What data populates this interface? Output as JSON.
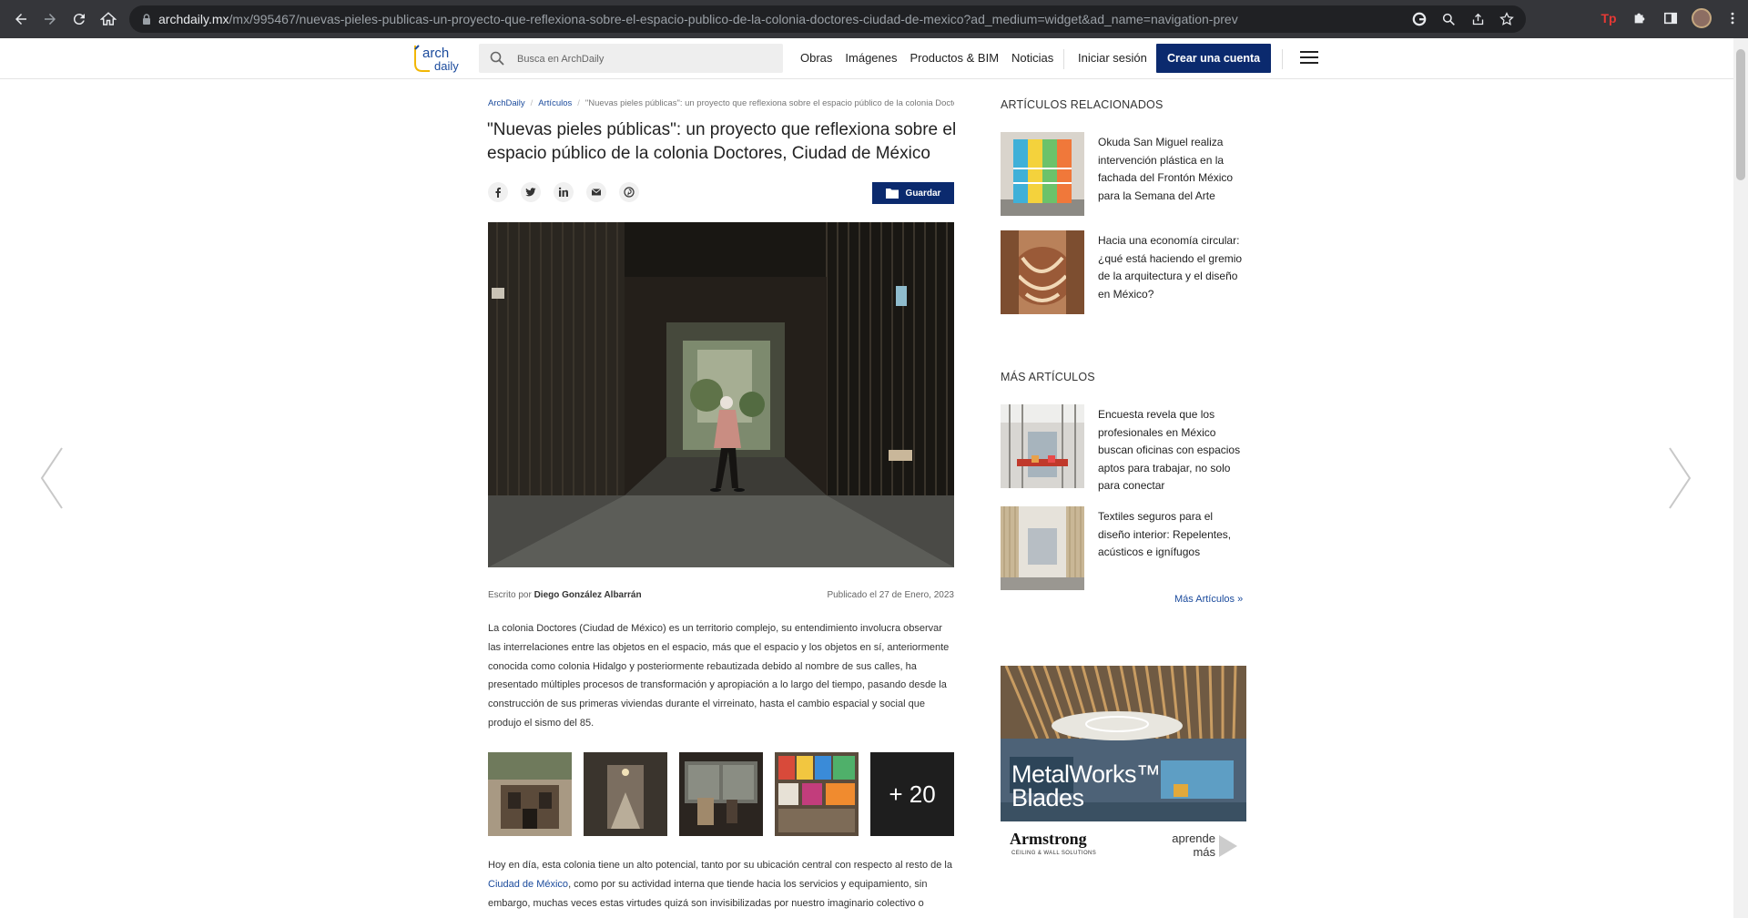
{
  "browser": {
    "url_host": "archdaily.mx",
    "url_path": "/mx/995467/nuevas-pieles-publicas-un-proyecto-que-reflexiona-sobre-el-espacio-publico-de-la-colonia-doctores-ciudad-de-mexico?ad_medium=widget&ad_name=navigation-prev",
    "extension_label": "Tp"
  },
  "header": {
    "logo_text_1": "arch",
    "logo_text_2": "daily",
    "search_placeholder": "Busca en ArchDaily",
    "nav": [
      "Obras",
      "Imágenes",
      "Productos & BIM",
      "Noticias"
    ],
    "login": "Iniciar sesión",
    "signup": "Crear una cuenta"
  },
  "article": {
    "breadcrumb": [
      "ArchDaily",
      "Artículos",
      "\"Nuevas pieles públicas\": un proyecto que reflexiona sobre el espacio público de la colonia Doctores, Ciudad de México"
    ],
    "title": "\"Nuevas pieles públicas\": un proyecto que reflexiona sobre el espacio público de la colonia Doctores, Ciudad de México",
    "save_label": "Guardar",
    "byline_prefix": "Escrito por ",
    "author": "Diego González Albarrán",
    "published": "Publicado el 27 de Enero, 2023",
    "paragraph1": "La colonia Doctores (Ciudad de México) es un territorio complejo, su entendimiento involucra observar las interrelaciones entre las objetos en el espacio, más que el espacio y los objetos en sí, anteriormente conocida como colonia Hidalgo y posteriormente rebautizada debido al nombre de sus calles, ha presentado múltiples procesos de transformación y apropiación a lo largo del tiempo, pasando desde la construcción de sus primeras viviendas durante el virreinato, hasta el cambio espacial y social que produjo el sismo del 85.",
    "gallery_more": "+ 20",
    "paragraph2_a": "Hoy en día, esta colonia tiene un alto potencial, tanto por su ubicación central con respecto al resto de la ",
    "paragraph2_link": "Ciudad de México",
    "paragraph2_b": ", como por su actividad interna que tiende hacia los servicios y equipamiento, sin embargo, muchas veces estas virtudes quizá son invisibilizadas por nuestro imaginario colectivo o"
  },
  "sidebar": {
    "related_heading": "ARTÍCULOS RELACIONADOS",
    "related": [
      {
        "title": "Okuda San Miguel realiza intervención plástica en la fachada del Frontón México para la Semana del Arte"
      },
      {
        "title": "Hacia una economía circular: ¿qué está haciendo el gremio de la arquitectura y el diseño en México?"
      }
    ],
    "more_heading": "MÁS ARTÍCULOS",
    "more": [
      {
        "title": "Encuesta revela que los profesionales en México buscan oficinas con espacios aptos para trabajar, no solo para conectar"
      },
      {
        "title": "Textiles seguros para el diseño interior: Repelentes, acústicos e ignífugos"
      }
    ],
    "more_link": "Más Artículos »"
  },
  "ad": {
    "title_line1": "MetalWorks™",
    "title_line2": "Blades",
    "brand": "Armstrong",
    "brand_sub": "CEILING & WALL SOLUTIONS",
    "cta": "aprende más"
  },
  "colors": {
    "brand_navy": "#0b2a6e",
    "link_blue": "#1a4a9c",
    "chrome_dark": "#35363a"
  }
}
